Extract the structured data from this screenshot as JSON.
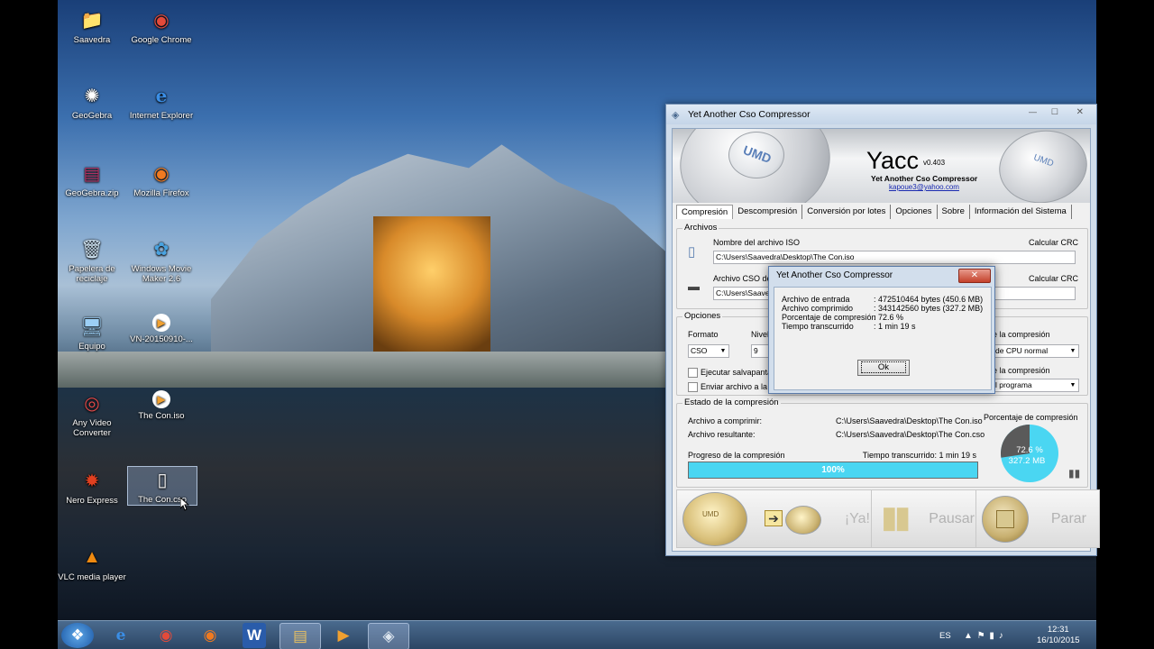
{
  "desktop": {
    "icons": [
      {
        "label": "Saavedra",
        "glyph": "📁",
        "color": "#e8b84a"
      },
      {
        "label": "Google Chrome",
        "glyph": "◉",
        "color": "#e34a3a"
      },
      {
        "label": "GeoGebra",
        "glyph": "✺",
        "color": "#ffffff"
      },
      {
        "label": "Internet Explorer",
        "glyph": "e",
        "color": "#3a8ee6"
      },
      {
        "label": "GeoGebra.zip",
        "glyph": "▤",
        "color": "#b03060"
      },
      {
        "label": "Mozilla Firefox",
        "glyph": "◉",
        "color": "#f07a20"
      },
      {
        "label": "Papelera de reciclaje",
        "glyph": "🗑",
        "color": "#cfe3f2"
      },
      {
        "label": "Windows Movie Maker 2.6",
        "glyph": "✿",
        "color": "#4aa3e0"
      },
      {
        "label": "Equipo",
        "glyph": "🖥",
        "color": "#9ccff5"
      },
      {
        "label": "VN-20150910-...",
        "glyph": "▶",
        "color": "#f0a030"
      },
      {
        "label": "Any Video Converter",
        "glyph": "◎",
        "color": "#e24a4a"
      },
      {
        "label": "The Con.iso",
        "glyph": "▶",
        "color": "#f0a030"
      },
      {
        "label": "Nero Express",
        "glyph": "✹",
        "color": "#e04020"
      },
      {
        "label": "The Con.cso",
        "glyph": "▯",
        "color": "#ffffff"
      },
      {
        "label": "VLC media player",
        "glyph": "▲",
        "color": "#f08a10"
      }
    ]
  },
  "taskbar": {
    "start_glyph": "❖",
    "apps": [
      "e",
      "◉",
      "◉",
      "W",
      "▤",
      "▶",
      "◈"
    ],
    "language": "ES",
    "tray_icons": "▲  ⚑  ▮  ♪",
    "time": "12:31",
    "date": "16/10/2015"
  },
  "window": {
    "title": "Yet Another Cso Compressor",
    "controls": {
      "minimize": "—",
      "maximize": "☐",
      "close": "✕"
    },
    "banner": {
      "umd_label_left": "UMD",
      "umd_label_right": "UMD",
      "app_name": "Yacc",
      "version": "v0.403",
      "tagline": "Yet Another Cso Compressor",
      "email": "kapoue3@yahoo.com"
    },
    "tabs": [
      "Compresión",
      "Descompresión",
      "Conversión por lotes",
      "Opciones",
      "Sobre",
      "Información del Sistema"
    ],
    "archivos": {
      "group_label": "Archivos",
      "iso_label": "Nombre del archivo ISO",
      "iso_calc": "Calcular CRC",
      "iso_path": "C:\\Users\\Saavedra\\Desktop\\The Con.iso",
      "cso_label": "Archivo CSO de",
      "cso_calc": "Calcular CRC",
      "cso_path": "C:\\Users\\Saave"
    },
    "opciones": {
      "group_label": "Opciones",
      "formato_label": "Formato",
      "formato_value": "CSO",
      "nivel_label": "Nivel",
      "nivel_value": "9",
      "priority_label": "e la compresión",
      "priority_value": "de CPU normal",
      "after_label": "e la compresión",
      "after_value": "l programa",
      "chk_screensaver": "Ejecutar salvapanta",
      "chk_send": "Enviar archivo a la F"
    },
    "estado": {
      "group_label": "Estado de la compresión",
      "archivo_label": "Archivo a comprimir:",
      "archivo_value": "C:\\Users\\Saavedra\\Desktop\\The Con.iso",
      "resultante_label": "Archivo resultante:",
      "resultante_value": "C:\\Users\\Saavedra\\Desktop\\The Con.cso",
      "progreso_label": "Progreso de la compresión",
      "tiempo_label": "Tiempo transcurrido: 1 min 19 s",
      "progress_fraction": 1.0,
      "progress_text": "100%",
      "pie_label": "Porcentaje de compresión",
      "pie_percent": "72.6 %",
      "pie_size": "327.2 MB",
      "pie_fraction": 0.726
    },
    "buttons": {
      "go": "¡Ya!",
      "pause": "Pausar",
      "stop": "Parar",
      "umd_mini": "UMD"
    }
  },
  "dialog": {
    "title": "Yet Another Cso Compressor",
    "close": "✕",
    "rows": [
      {
        "label": "Archivo de entrada",
        "value": ": 472510464 bytes (450.6 MB)"
      },
      {
        "label": "Archivo comprimido",
        "value": ": 343142560 bytes (327.2 MB)"
      },
      {
        "label": "Porcentaje de compresión",
        "value": ": 72.6 %"
      },
      {
        "label": "Tiempo transcurrido",
        "value": ": 1 min 19 s"
      }
    ],
    "ok": "Ok"
  }
}
